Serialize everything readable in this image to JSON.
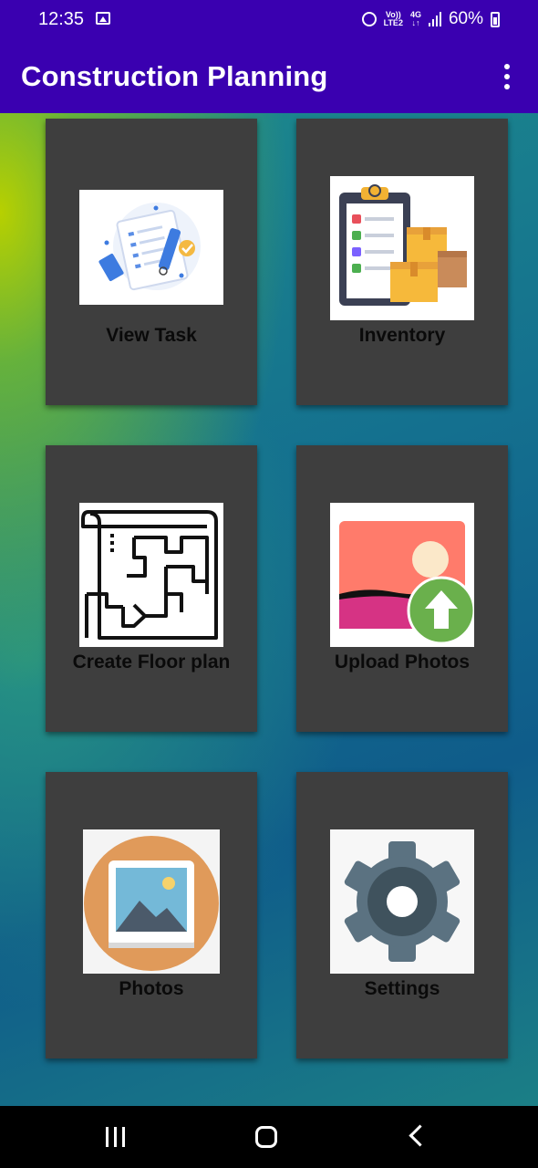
{
  "status_bar": {
    "time": "12:35",
    "network_top": "Vo))",
    "network_bottom": "LTE2",
    "network_type": "4G",
    "battery": "60%"
  },
  "app_bar": {
    "title": "Construction Planning",
    "menu_icon": "overflow-menu-icon"
  },
  "tiles": [
    {
      "label": "View Task",
      "icon": "task-list-icon"
    },
    {
      "label": "Inventory",
      "icon": "clipboard-boxes-icon"
    },
    {
      "label": "Create  Floor plan",
      "icon": "floor-plan-icon"
    },
    {
      "label": "Upload Photos",
      "icon": "upload-photo-icon"
    },
    {
      "label": "Photos",
      "icon": "photo-gallery-icon"
    },
    {
      "label": "Settings",
      "icon": "gear-icon"
    }
  ],
  "nav_bar": {
    "recents_icon": "recents-icon",
    "home_icon": "home-icon",
    "back_icon": "back-icon"
  },
  "colors": {
    "app_bar": "#3a00b0",
    "tile_bg": "#3e3e3e",
    "nav_bar": "#000000"
  }
}
